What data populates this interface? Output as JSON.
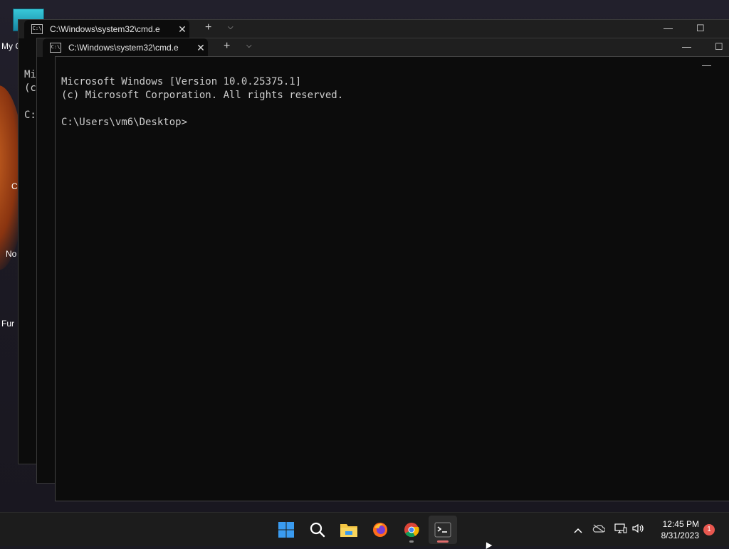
{
  "desktop": {
    "icons": [
      {
        "label": "My C"
      },
      {
        "label": ""
      },
      {
        "label": "C"
      },
      {
        "label": "No"
      },
      {
        "label": "Fur"
      }
    ]
  },
  "windows": [
    {
      "tab_title": "C:\\Windows\\system32\\cmd.e",
      "lines": [
        "Mi",
        "(c",
        "",
        "C:"
      ]
    },
    {
      "tab_title": "C:\\Windows\\system32\\cmd.e",
      "lines": []
    },
    {
      "tab_title": "",
      "lines": [
        "Microsoft Windows [Version 10.0.25375.1]",
        "(c) Microsoft Corporation. All rights reserved.",
        "",
        "C:\\Users\\vm6\\Desktop>"
      ]
    }
  ],
  "window_controls": {
    "new_tab": "+",
    "dropdown": "⌵",
    "close_tab": "✕",
    "minimize": "—",
    "maximize": "☐"
  },
  "taskbar": {
    "apps": [
      {
        "name": "Start"
      },
      {
        "name": "Search"
      },
      {
        "name": "File Explorer"
      },
      {
        "name": "Firefox"
      },
      {
        "name": "Google Chrome"
      },
      {
        "name": "Terminal"
      }
    ],
    "clock": {
      "time": "12:45 PM",
      "date": "8/31/2023"
    },
    "notification_count": "1",
    "colors": {
      "start_blue": "#3a9bf0",
      "folder_yellow": "#f4c542",
      "terminal_indicator": "#e06c6c"
    }
  }
}
